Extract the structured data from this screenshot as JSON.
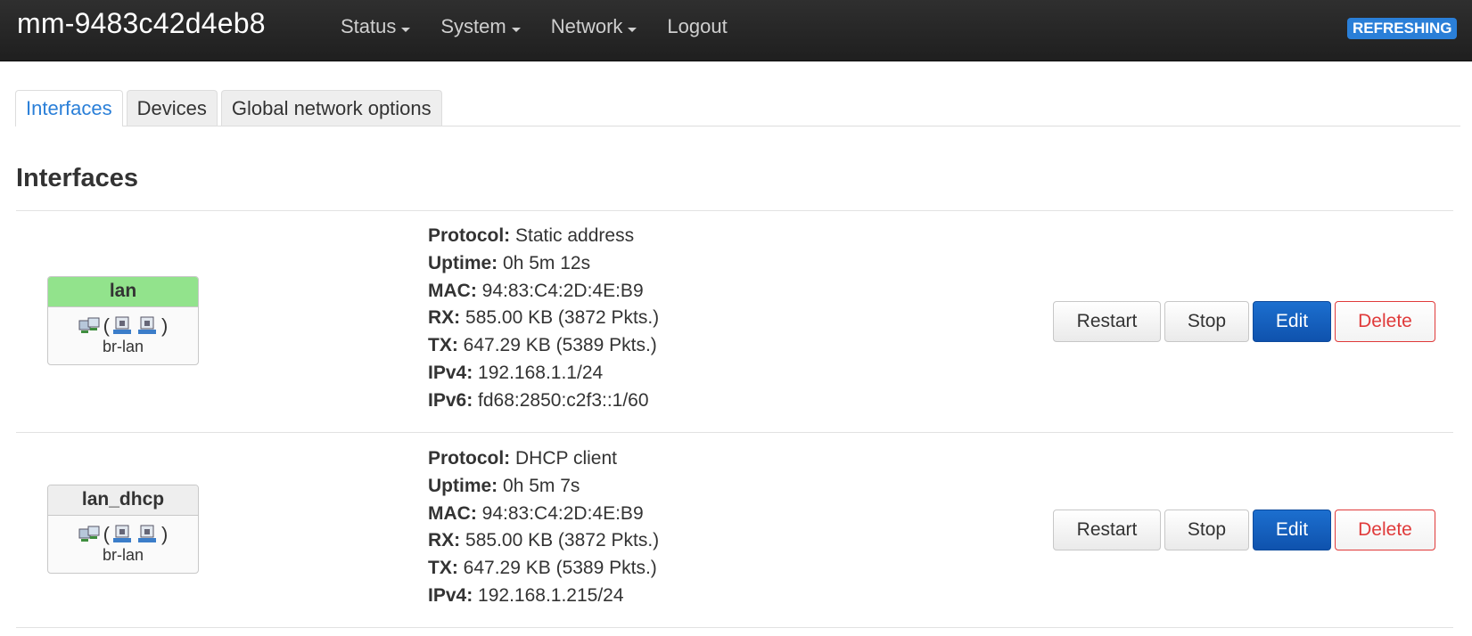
{
  "header": {
    "brand": "mm-9483c42d4eb8",
    "menu": [
      {
        "label": "Status",
        "dropdown": true
      },
      {
        "label": "System",
        "dropdown": true
      },
      {
        "label": "Network",
        "dropdown": true
      },
      {
        "label": "Logout",
        "dropdown": false
      }
    ],
    "status_badge": "REFRESHING"
  },
  "tabs": [
    {
      "label": "Interfaces",
      "active": true
    },
    {
      "label": "Devices",
      "active": false
    },
    {
      "label": "Global network options",
      "active": false
    }
  ],
  "section": {
    "title": "Interfaces"
  },
  "interfaces": [
    {
      "name": "lan",
      "header_color": "#92e38c",
      "device": "br-lan",
      "info": {
        "protocol_label": "Protocol:",
        "protocol": "Static address",
        "uptime_label": "Uptime:",
        "uptime": "0h 5m 12s",
        "mac_label": "MAC:",
        "mac": "94:83:C4:2D:4E:B9",
        "rx_label": "RX:",
        "rx": "585.00 KB (3872 Pkts.)",
        "tx_label": "TX:",
        "tx": "647.29 KB (5389 Pkts.)",
        "ipv4_label": "IPv4:",
        "ipv4": "192.168.1.1/24",
        "ipv6_label": "IPv6:",
        "ipv6": "fd68:2850:c2f3::1/60"
      },
      "buttons": {
        "restart": "Restart",
        "stop": "Stop",
        "edit": "Edit",
        "delete": "Delete"
      }
    },
    {
      "name": "lan_dhcp",
      "header_color": "#eeeeee",
      "device": "br-lan",
      "info": {
        "protocol_label": "Protocol:",
        "protocol": "DHCP client",
        "uptime_label": "Uptime:",
        "uptime": "0h 5m 7s",
        "mac_label": "MAC:",
        "mac": "94:83:C4:2D:4E:B9",
        "rx_label": "RX:",
        "rx": "585.00 KB (3872 Pkts.)",
        "tx_label": "TX:",
        "tx": "647.29 KB (5389 Pkts.)",
        "ipv4_label": "IPv4:",
        "ipv4": "192.168.1.215/24"
      },
      "buttons": {
        "restart": "Restart",
        "stop": "Stop",
        "edit": "Edit",
        "delete": "Delete"
      }
    }
  ],
  "icons": {
    "bridge": "network-bridge-icon",
    "port": "ethernet-port-icon"
  }
}
